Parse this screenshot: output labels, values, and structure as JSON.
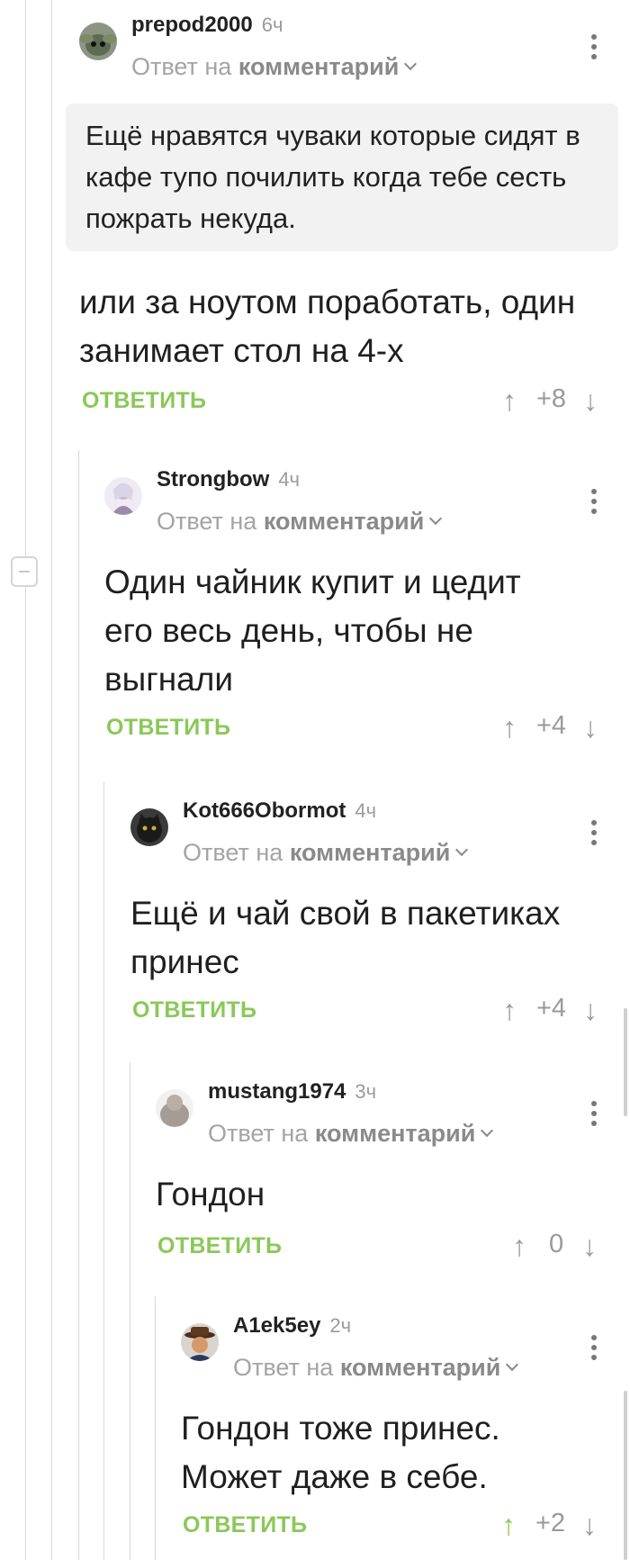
{
  "ui": {
    "collapse_symbol": "−"
  },
  "comments": [
    {
      "user": "prepod2000",
      "time": "6ч",
      "reply_prefix": "Ответ на",
      "reply_target": "комментарий",
      "quote": "Ещё нравятся чуваки которые сидят в кафе тупо почилить когда тебе сесть пожрать некуда.",
      "text": "или за ноутом поработать, один занимает стол на 4-х",
      "reply_label": "ОТВЕТИТЬ",
      "rating": "+8",
      "avatar_color": "#6f7565"
    },
    {
      "user": "Strongbow",
      "time": "4ч",
      "reply_prefix": "Ответ на",
      "reply_target": "комментарий",
      "text": "Один чайник купит и цедит его весь день, чтобы не выгнали",
      "reply_label": "ОТВЕТИТЬ",
      "rating": "+4",
      "avatar_color": "#8a7c9a"
    },
    {
      "user": "Kot666Obormot",
      "time": "4ч",
      "reply_prefix": "Ответ на",
      "reply_target": "комментарий",
      "text": "Ещё и чай свой в пакетиках принес",
      "reply_label": "ОТВЕТИТЬ",
      "rating": "+4",
      "avatar_color": "#2a2a2a"
    },
    {
      "user": "mustang1974",
      "time": "3ч",
      "reply_prefix": "Ответ на",
      "reply_target": "комментарий",
      "text": "Гондон",
      "reply_label": "ОТВЕТИТЬ",
      "rating": "0",
      "avatar_color": "#a9a4a0"
    },
    {
      "user": "A1ek5ey",
      "time": "2ч",
      "reply_prefix": "Ответ на",
      "reply_target": "комментарий",
      "text": "Гондон тоже принес. Может даже в себе.",
      "reply_label": "ОТВЕТИТЬ",
      "rating": "+2",
      "avatar_color": "#6b4a2a",
      "upvoted": true
    }
  ],
  "colors": {
    "accent_green": "#8ac858",
    "muted": "#9a9a9a"
  }
}
